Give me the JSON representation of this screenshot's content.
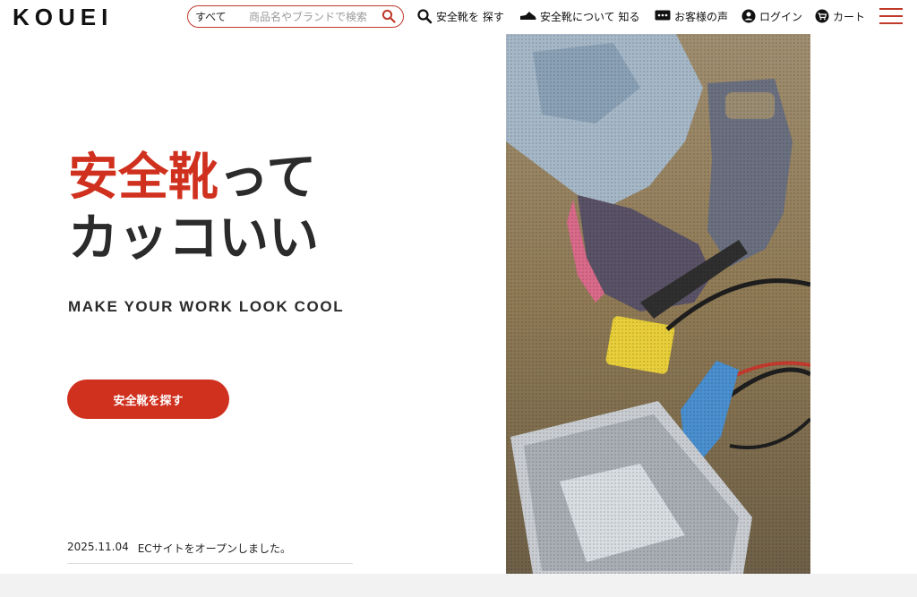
{
  "header": {
    "logo": "KOUEI",
    "search": {
      "scope": "すべて",
      "placeholder": "商品名やブランドで検索"
    },
    "nav": [
      {
        "label": "安全靴を 探す",
        "icon": "search-icon"
      },
      {
        "label": "安全靴について 知る",
        "icon": "shoe-icon"
      },
      {
        "label": "お客様の声",
        "icon": "speech-bubble-icon"
      },
      {
        "label": "ログイン",
        "icon": "user-icon"
      },
      {
        "label": "カート",
        "icon": "cart-icon"
      }
    ],
    "menu_icon": "hamburger-menu-icon"
  },
  "hero": {
    "headline_accent": "安全靴",
    "headline_rest": "って",
    "headline_line2": "カッコいい",
    "subline": "MAKE YOUR WORK LOOK COOL",
    "cta_label": "安全靴を探す"
  },
  "news": [
    {
      "date": "2025.11.04",
      "text": "ECサイトをオープンしました。"
    }
  ],
  "colors": {
    "accent": "#d0311f",
    "text": "#2b2b2b",
    "footer_bg": "#f2f2f2"
  }
}
